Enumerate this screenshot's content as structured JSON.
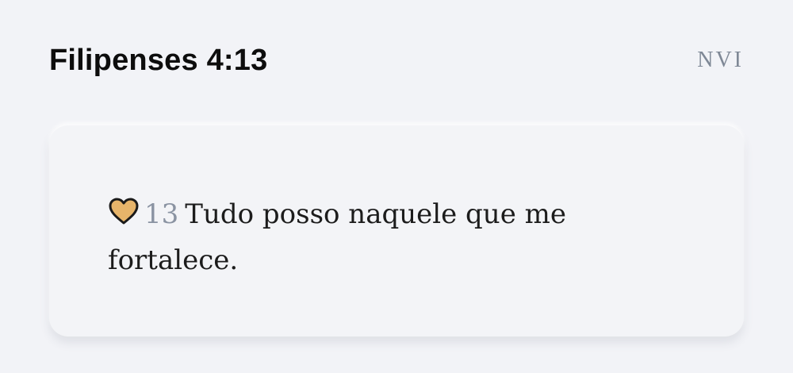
{
  "header": {
    "reference": "Filipenses 4:13",
    "version": "NVI"
  },
  "verse": {
    "number": "13",
    "text": "Tudo posso naquele que me fortalece.",
    "favorite_icon": "heart-icon",
    "favorite_color": "#e6b46a"
  }
}
